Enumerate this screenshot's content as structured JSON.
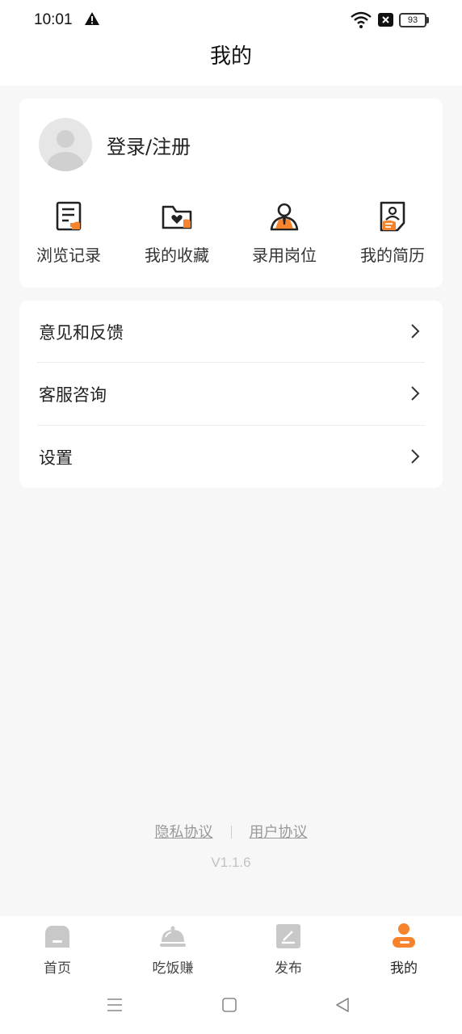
{
  "status_bar": {
    "time": "10:01",
    "battery": "93",
    "icons": [
      "warning-icon",
      "wifi-icon",
      "sim-off-icon",
      "battery-icon"
    ]
  },
  "header": {
    "title": "我的"
  },
  "profile": {
    "login_label": "登录/注册",
    "quick_actions": [
      {
        "label": "浏览记录",
        "icon": "history-icon"
      },
      {
        "label": "我的收藏",
        "icon": "favorites-folder-icon"
      },
      {
        "label": "录用岗位",
        "icon": "hired-position-icon"
      },
      {
        "label": "我的简历",
        "icon": "resume-icon"
      }
    ]
  },
  "menu": [
    {
      "label": "意见和反馈"
    },
    {
      "label": "客服咨询"
    },
    {
      "label": "设置"
    }
  ],
  "footer": {
    "privacy_link": "隐私协议",
    "user_agreement_link": "用户协议",
    "version": "V1.1.6"
  },
  "tab_bar": {
    "active_index": 3,
    "accent_color": "#f5842c",
    "inactive_color": "#c8c8c8",
    "tabs": [
      {
        "label": "首页",
        "icon": "home-icon"
      },
      {
        "label": "吃饭赚",
        "icon": "food-cloche-icon"
      },
      {
        "label": "发布",
        "icon": "publish-edit-icon"
      },
      {
        "label": "我的",
        "icon": "profile-icon"
      }
    ]
  },
  "system_nav": [
    "menu-icon",
    "home-square-icon",
    "back-triangle-icon"
  ]
}
